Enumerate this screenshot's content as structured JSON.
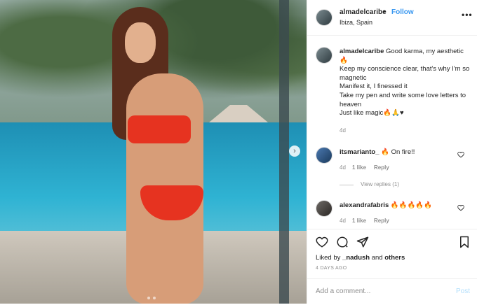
{
  "header": {
    "username": "almadelcaribe",
    "separator": "•",
    "follow_label": "Follow",
    "location": "Ibiza, Spain",
    "more_icon": "more-horizontal-icon"
  },
  "caption": {
    "username": "almadelcaribe",
    "lines": [
      "Good karma, my aesthetic 🔥",
      "Keep my conscience clear, that's why I'm so magnetic",
      "Manifest it, I finessed it",
      "Take my pen and write some love letters to heaven",
      "Just like magic🔥🙏♥"
    ],
    "age": "4d"
  },
  "comments": [
    {
      "username": "itsmarianto_",
      "text": "🔥 On fire!!",
      "age": "4d",
      "likes": "1 like",
      "reply": "Reply",
      "view_replies": "View replies (1)"
    },
    {
      "username": "alexandrafabris",
      "text": "🔥🔥🔥🔥🔥",
      "age": "4d",
      "likes": "1 like",
      "reply": "Reply"
    }
  ],
  "actions": {
    "icons": [
      "heart-icon",
      "comment-icon",
      "share-icon",
      "bookmark-icon"
    ],
    "likes_prefix": "Liked by",
    "liked_by_user": "_nadush",
    "likes_conj": "and",
    "likes_others": "others",
    "posted_ago": "4 DAYS AGO"
  },
  "add_comment": {
    "placeholder": "Add a comment...",
    "post_label": "Post"
  },
  "colors": {
    "link_blue": "#3897f0",
    "post_disabled": "#b2dffc",
    "muted": "#8e8e8e"
  }
}
